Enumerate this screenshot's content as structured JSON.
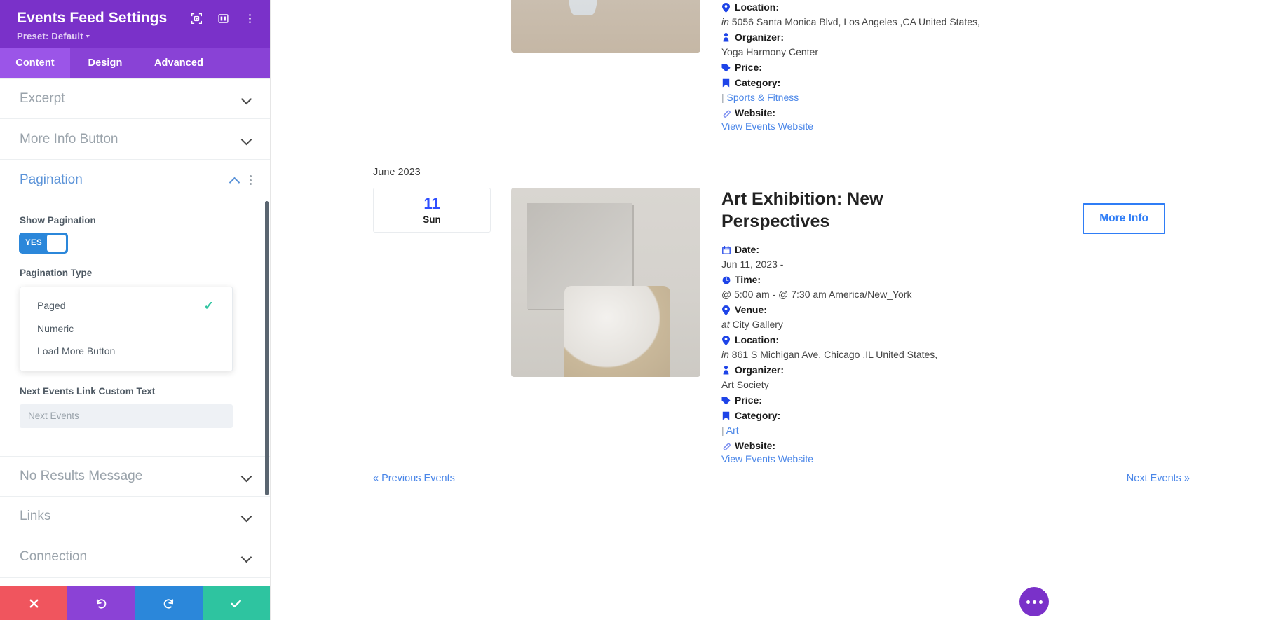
{
  "sidebar": {
    "title": "Events Feed Settings",
    "preset": "Preset: Default",
    "header_icons": [
      "focus-icon",
      "layout-icon",
      "more-vertical-icon"
    ],
    "tabs": [
      {
        "label": "Content",
        "active": true
      },
      {
        "label": "Design",
        "active": false
      },
      {
        "label": "Advanced",
        "active": false
      }
    ],
    "sections": [
      {
        "label": "Excerpt",
        "open": false
      },
      {
        "label": "More Info Button",
        "open": false
      },
      {
        "label": "Pagination",
        "open": true
      },
      {
        "label": "No Results Message",
        "open": false
      },
      {
        "label": "Links",
        "open": false
      },
      {
        "label": "Connection",
        "open": false
      }
    ],
    "pagination": {
      "show_pagination_label": "Show Pagination",
      "toggle_value": "YES",
      "pagination_type_label": "Pagination Type",
      "options": [
        {
          "label": "Paged",
          "selected": true
        },
        {
          "label": "Numeric",
          "selected": false
        },
        {
          "label": "Load More Button",
          "selected": false
        }
      ],
      "next_events_label": "Next Events Link Custom Text",
      "next_events_value": "",
      "next_events_placeholder": "Next Events"
    },
    "footer": {
      "cancel": "cancel-icon",
      "undo": "undo-icon",
      "redo": "redo-icon",
      "save": "save-check-icon"
    },
    "colors": {
      "header": "#7A31C9",
      "tabbar": "#8942D6",
      "tab_active": "#9B55E8",
      "toggle_on": "#2B87DA",
      "check": "#2EC4A0",
      "cancel": "#F0555E",
      "undo": "#8B42D6",
      "redo": "#2B87DA",
      "save": "#2EC4A0"
    }
  },
  "feed": {
    "event_top": {
      "labels": {
        "location": "Location:",
        "organizer": "Organizer:",
        "price": "Price:",
        "category": "Category:",
        "website": "Website:"
      },
      "location_pre": "in",
      "location": "5056 Santa Monica Blvd, Los Angeles ,CA United States,",
      "organizer": "Yoga Harmony Center",
      "price": "",
      "category_sep": "|",
      "category": "Sports & Fitness",
      "website_link": "View Events Website"
    },
    "month_heading": "June 2023",
    "event_main": {
      "date_day": "11",
      "date_dow": "Sun",
      "title": "Art Exhibition: New Perspectives",
      "more_info_label": "More Info",
      "labels": {
        "date": "Date:",
        "time": "Time:",
        "venue": "Venue:",
        "location": "Location:",
        "organizer": "Organizer:",
        "price": "Price:",
        "category": "Category:",
        "website": "Website:"
      },
      "date": "Jun 11, 2023 -",
      "time": "@ 5:00 am - @ 7:30 am America/New_York",
      "venue_pre": "at",
      "venue": "City Gallery",
      "location_pre": "in",
      "location": "861 S Michigan Ave, Chicago ,IL United States,",
      "organizer": "Art Society",
      "price": "",
      "category_sep": "|",
      "category": "Art",
      "website_link": "View Events Website"
    },
    "pagination": {
      "previous": "« Previous Events",
      "next": "Next Events »"
    },
    "link_color": "#4A86E8",
    "accent_blue": "#2F7DF6"
  }
}
